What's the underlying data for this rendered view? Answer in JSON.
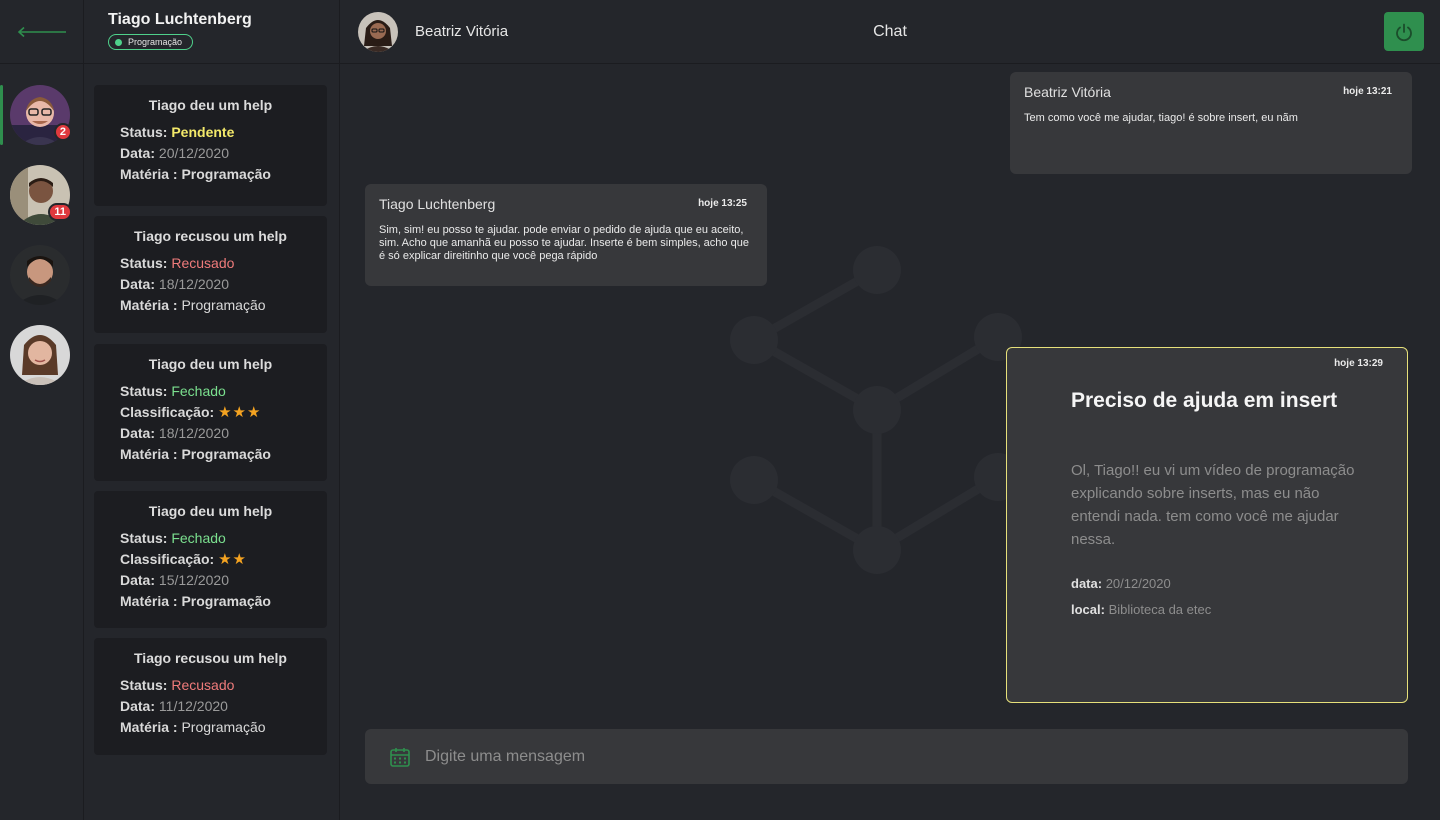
{
  "history": {
    "name": "Tiago Luchtenberg",
    "tag": "Programação",
    "cards": [
      {
        "title": "Tiago deu um help",
        "status_label": "Status:",
        "status": "Pendente",
        "data_label": "Data:",
        "data": "20/12/2020",
        "materia_label": "Matéria :",
        "materia": "Programação"
      },
      {
        "title": "Tiago recusou um help",
        "status_label": "Status:",
        "status": "Recusado",
        "data_label": "Data:",
        "data": "18/12/2020",
        "materia_label": "Matéria :",
        "materia": "Programação"
      },
      {
        "title": "Tiago deu um help",
        "status_label": "Status:",
        "status": "Fechado",
        "class_label": "Classificação:",
        "rating": 3,
        "data_label": "Data:",
        "data": "18/12/2020",
        "materia_label": "Matéria :",
        "materia": "Programação"
      },
      {
        "title": "Tiago deu um help",
        "status_label": "Status:",
        "status": "Fechado",
        "class_label": "Classificação:",
        "rating": 2,
        "data_label": "Data:",
        "data": "15/12/2020",
        "materia_label": "Matéria :",
        "materia": "Programação"
      },
      {
        "title": "Tiago recusou um help",
        "status_label": "Status:",
        "status": "Recusado",
        "data_label": "Data:",
        "data": "11/12/2020",
        "materia_label": "Matéria :",
        "materia": "Programação"
      }
    ]
  },
  "rail": {
    "back_icon": "arrow-left-icon",
    "contacts": [
      {
        "badge": "2",
        "active": true
      },
      {
        "badge": "11",
        "active": false
      },
      {
        "badge": null,
        "active": false
      },
      {
        "badge": null,
        "active": false
      }
    ]
  },
  "chat": {
    "contact_name": "Beatriz Vitória",
    "title": "Chat",
    "power_icon": "power-icon",
    "accent": "#2f8f4e",
    "messages": [
      {
        "author": "Beatriz Vitória",
        "time": "hoje 13:21",
        "text": "Tem como você me ajudar, tiago! é sobre insert, eu nãm"
      },
      {
        "author": "Tiago Luchtenberg",
        "time": "hoje 13:25",
        "text": "Sim,  sim! eu posso te ajudar. pode enviar o pedido de ajuda que eu aceito, sim. Acho que amanhã eu posso te ajudar. Inserte é bem simples, acho que é só explicar direitinho que você pega  rápido"
      }
    ],
    "help_request": {
      "time": "hoje 13:29",
      "title": "Preciso de ajuda em insert",
      "description": "Ol, Tiago!! eu vi um vídeo de programação explicando sobre inserts, mas eu não entendi nada. tem como você me ajudar nessa.",
      "data_label": "data:",
      "data": "20/12/2020",
      "local_label": "local:",
      "local": "Biblioteca da etec"
    },
    "composer": {
      "placeholder": "Digite uma mensagem",
      "icon": "calendar-icon"
    }
  }
}
